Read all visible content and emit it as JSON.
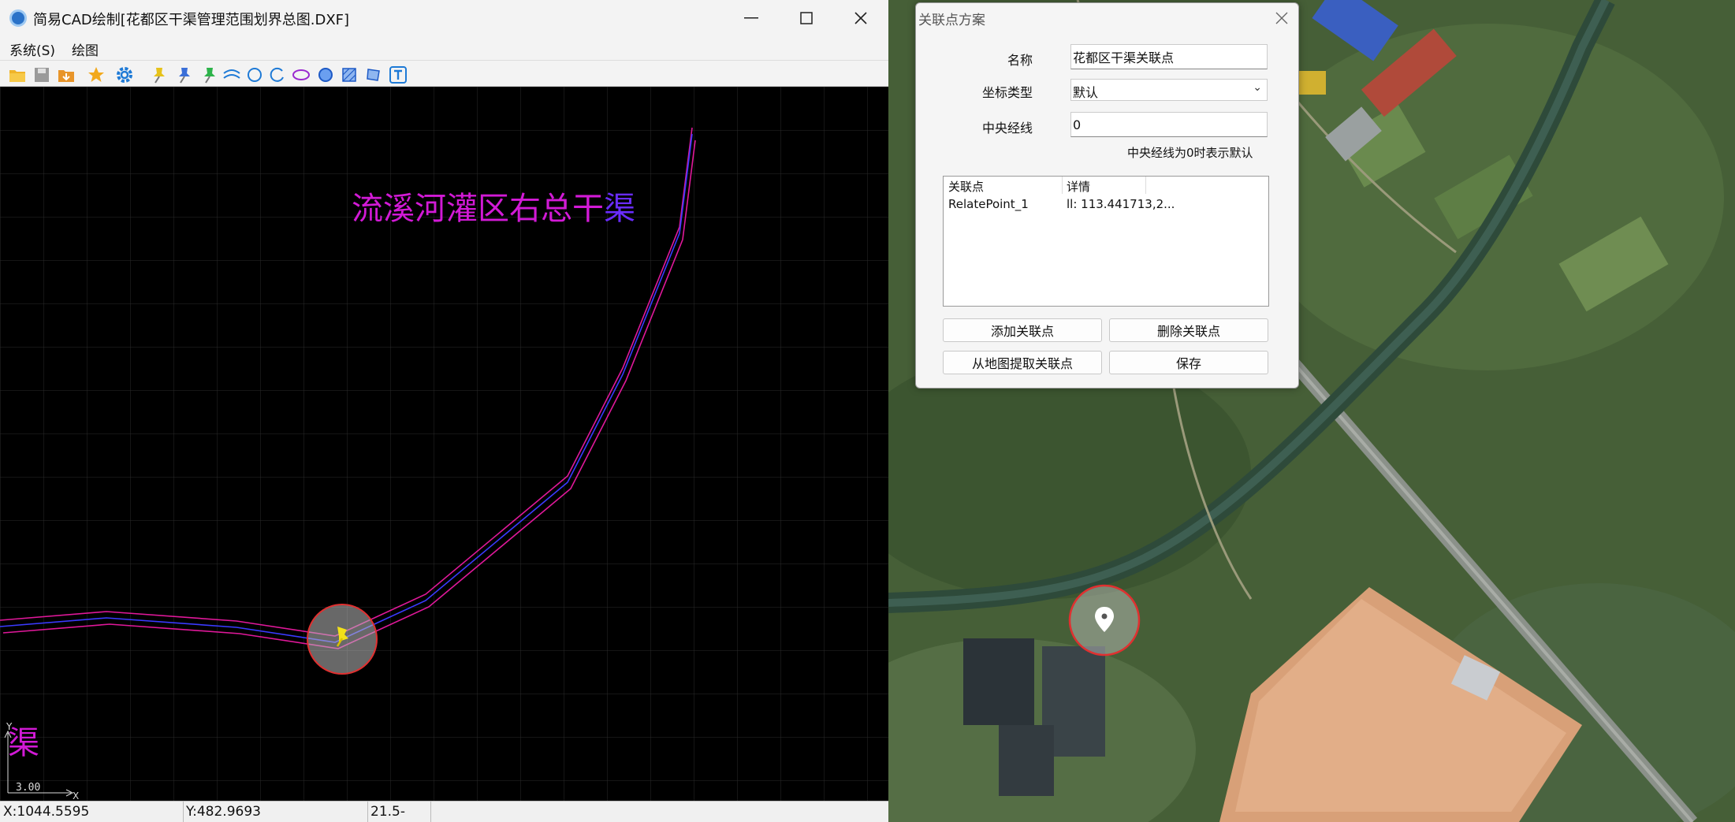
{
  "cad_window": {
    "title": "简易CAD绘制[花都区干渠管理范围划界总图.DXF]",
    "menu": {
      "system": "系统(S)",
      "draw": "绘图"
    },
    "canvas": {
      "title_label_main": "流溪河灌区右总干",
      "title_label_last": "渠",
      "corner_label": "渠",
      "axis_y": "Y",
      "axis_x": "X",
      "axis_scale": "3.00"
    },
    "status": {
      "x": "X:1044.5595",
      "y": "Y:482.9693",
      "z": "21.5-"
    },
    "toolbar_icons": [
      "open-folder-icon",
      "save-icon",
      "export-icon",
      "favorite-star-icon",
      "settings-gear-icon",
      "pin-yellow-icon",
      "pin-blue-icon",
      "pin-green-icon",
      "arc-line-icon",
      "circle-icon",
      "arc-icon",
      "ellipse-icon",
      "filled-circle-icon",
      "hatch-icon",
      "polygon-icon",
      "text-icon"
    ]
  },
  "dialog": {
    "title": "关联点方案",
    "name_label": "名称",
    "name_value": "花都区干渠关联点",
    "coord_type_label": "坐标类型",
    "coord_type_value": "默认",
    "meridian_label": "中央经线",
    "meridian_value": "0",
    "hint": "中央经线为0时表示默认",
    "list": {
      "headers": [
        "关联点",
        "详情"
      ],
      "rows": [
        {
          "point": "RelatePoint_1",
          "detail": "ll: 113.441713,2..."
        }
      ]
    },
    "buttons": {
      "add": "添加关联点",
      "delete": "删除关联点",
      "pick_from_map": "从地图提取关联点",
      "save": "保存"
    }
  },
  "colors": {
    "cad_text": "#d21ad6",
    "cad_accent": "#6a2cff",
    "canal_outline": "#e0189a",
    "canal_centerline": "#3a3aff",
    "marker_ring": "#e03030"
  }
}
